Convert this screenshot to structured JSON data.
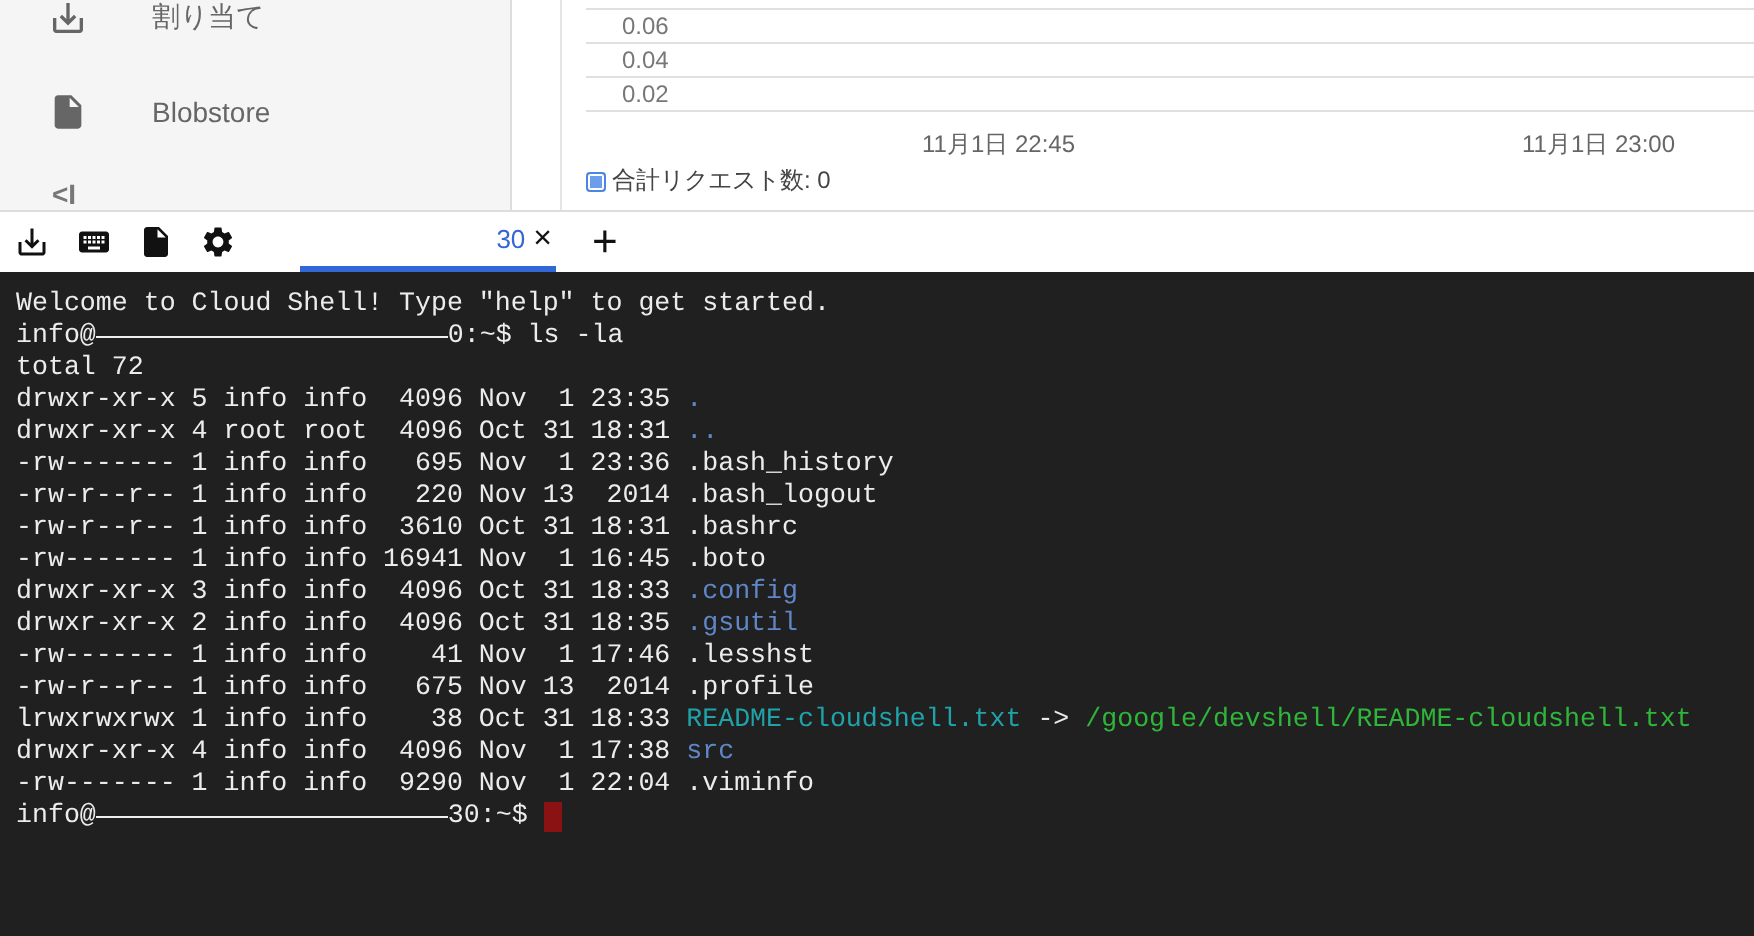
{
  "sidebar": {
    "items": [
      {
        "label": "割り当て",
        "kind": "quota"
      },
      {
        "label": "Blobstore",
        "kind": "file"
      }
    ],
    "collapse": "<I"
  },
  "chart": {
    "yticks": [
      "0.06",
      "0.04",
      "0.02"
    ],
    "xticks": [
      "11月1日 22:45",
      "11月1日 23:00"
    ],
    "legend": {
      "label": "合計リクエスト数: 0",
      "checked": true
    }
  },
  "toolbar": {
    "tabs": [
      {
        "label": "30",
        "close": "×",
        "selected": true
      }
    ],
    "add": "+"
  },
  "terminal": {
    "lines": [
      {
        "segments": [
          {
            "kind": "plain",
            "text": "Welcome to Cloud Shell! Type \"help\" to get started."
          }
        ]
      },
      {
        "segments": [
          {
            "kind": "plain",
            "text": "info@"
          },
          {
            "kind": "redacted"
          },
          {
            "kind": "plain",
            "text": "0:~$ ls -la"
          }
        ]
      },
      {
        "segments": [
          {
            "kind": "plain",
            "text": "total 72"
          }
        ]
      },
      {
        "segments": [
          {
            "kind": "plain",
            "text": "drwxr-xr-x 5 info info  4096 Nov  1 23:35 "
          },
          {
            "kind": "dir",
            "text": "."
          }
        ]
      },
      {
        "segments": [
          {
            "kind": "plain",
            "text": "drwxr-xr-x 4 root root  4096 Oct 31 18:31 "
          },
          {
            "kind": "dir",
            "text": ".."
          }
        ]
      },
      {
        "segments": [
          {
            "kind": "plain",
            "text": "-rw------- 1 info info   695 Nov  1 23:36 .bash_history"
          }
        ]
      },
      {
        "segments": [
          {
            "kind": "plain",
            "text": "-rw-r--r-- 1 info info   220 Nov 13  2014 .bash_logout"
          }
        ]
      },
      {
        "segments": [
          {
            "kind": "plain",
            "text": "-rw-r--r-- 1 info info  3610 Oct 31 18:31 .bashrc"
          }
        ]
      },
      {
        "segments": [
          {
            "kind": "plain",
            "text": "-rw------- 1 info info 16941 Nov  1 16:45 .boto"
          }
        ]
      },
      {
        "segments": [
          {
            "kind": "plain",
            "text": "drwxr-xr-x 3 info info  4096 Oct 31 18:33 "
          },
          {
            "kind": "dir",
            "text": ".config"
          }
        ]
      },
      {
        "segments": [
          {
            "kind": "plain",
            "text": "drwxr-xr-x 2 info info  4096 Oct 31 18:35 "
          },
          {
            "kind": "dir",
            "text": ".gsutil"
          }
        ]
      },
      {
        "segments": [
          {
            "kind": "plain",
            "text": "-rw------- 1 info info    41 Nov  1 17:46 .lesshst"
          }
        ]
      },
      {
        "segments": [
          {
            "kind": "plain",
            "text": "-rw-r--r-- 1 info info   675 Nov 13  2014 .profile"
          }
        ]
      },
      {
        "segments": [
          {
            "kind": "plain",
            "text": "lrwxrwxrwx 1 info info    38 Oct 31 18:33 "
          },
          {
            "kind": "link",
            "text": "README-cloudshell.txt"
          },
          {
            "kind": "plain",
            "text": " -> "
          },
          {
            "kind": "target",
            "text": "/google/devshell/README-cloudshell.txt"
          }
        ]
      },
      {
        "segments": [
          {
            "kind": "plain",
            "text": "drwxr-xr-x 4 info info  4096 Nov  1 17:38 "
          },
          {
            "kind": "dir",
            "text": "src"
          }
        ]
      },
      {
        "segments": [
          {
            "kind": "plain",
            "text": "-rw------- 1 info info  9290 Nov  1 22:04 .viminfo"
          }
        ]
      },
      {
        "segments": [
          {
            "kind": "plain",
            "text": "info@"
          },
          {
            "kind": "redacted"
          },
          {
            "kind": "plain",
            "text": "30:~$ "
          },
          {
            "kind": "cursor"
          }
        ]
      }
    ]
  }
}
